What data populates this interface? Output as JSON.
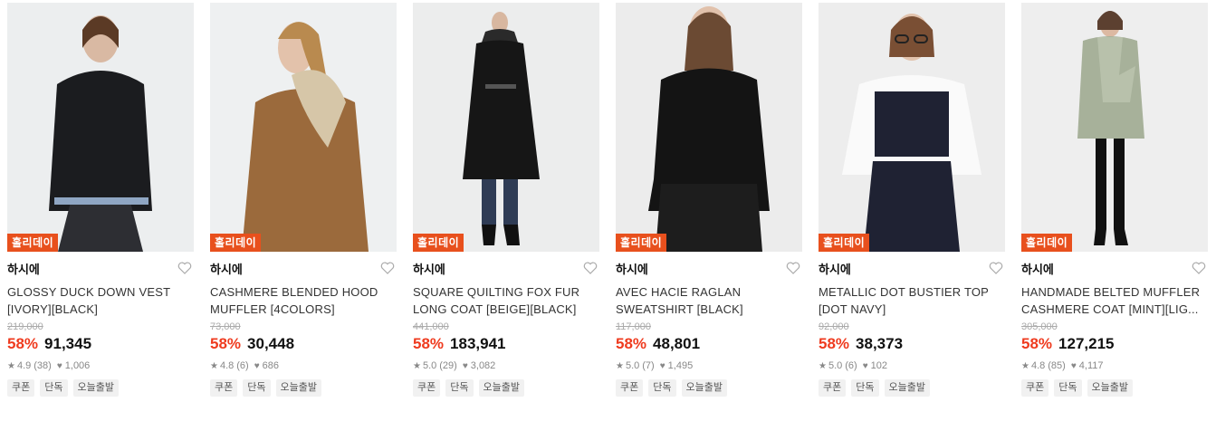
{
  "products": [
    {
      "badge": "홀리데이",
      "brand": "하시에",
      "name_line1": "GLOSSY DUCK DOWN VEST",
      "name_line2": "[IVORY][BLACK]",
      "original_price": "219,000",
      "discount": "58%",
      "price": "91,345",
      "rating": "4.9",
      "reviews": "(38)",
      "likes": "1,006",
      "tags": [
        "쿠폰",
        "단독",
        "오늘출발"
      ],
      "image_desc": "black-down-vest",
      "bg": "#eceeef",
      "garment": "#1b1c1f"
    },
    {
      "badge": "홀리데이",
      "brand": "하시에",
      "name_line1": "CASHMERE BLENDED HOOD",
      "name_line2": "MUFFLER [4COLORS]",
      "original_price": "73,000",
      "discount": "58%",
      "price": "30,448",
      "rating": "4.8",
      "reviews": "(6)",
      "likes": "686",
      "tags": [
        "쿠폰",
        "단독",
        "오늘출발"
      ],
      "image_desc": "camel-hood-muffler",
      "bg": "#eef0f1",
      "garment": "#9b6a3c"
    },
    {
      "badge": "홀리데이",
      "brand": "하시에",
      "name_line1": "SQUARE QUILTING FOX FUR",
      "name_line2": "LONG COAT [BEIGE][BLACK]",
      "original_price": "441,000",
      "discount": "58%",
      "price": "183,941",
      "rating": "5.0",
      "reviews": "(29)",
      "likes": "3,082",
      "tags": [
        "쿠폰",
        "단독",
        "오늘출발"
      ],
      "image_desc": "black-quilted-long-coat",
      "bg": "#eceded",
      "garment": "#161616"
    },
    {
      "badge": "홀리데이",
      "brand": "하시에",
      "name_line1": "AVEC HACIE RAGLAN",
      "name_line2": "SWEATSHIRT [BLACK]",
      "original_price": "117,000",
      "discount": "58%",
      "price": "48,801",
      "rating": "5.0",
      "reviews": "(7)",
      "likes": "1,495",
      "tags": [
        "쿠폰",
        "단독",
        "오늘출발"
      ],
      "image_desc": "black-raglan-sweatshirt",
      "bg": "#ececec",
      "garment": "#141414"
    },
    {
      "badge": "홀리데이",
      "brand": "하시에",
      "name_line1": "METALLIC DOT BUSTIER TOP",
      "name_line2": "[DOT NAVY]",
      "original_price": "92,000",
      "discount": "58%",
      "price": "38,373",
      "rating": "5.0",
      "reviews": "(6)",
      "likes": "102",
      "tags": [
        "쿠폰",
        "단독",
        "오늘출발"
      ],
      "image_desc": "navy-dot-bustier-top",
      "bg": "#ededed",
      "garment": "#1f2233"
    },
    {
      "badge": "홀리데이",
      "brand": "하시에",
      "name_line1": "HANDMADE BELTED MUFFLER",
      "name_line2": "CASHMERE COAT [MINT][LIG...",
      "original_price": "305,000",
      "discount": "58%",
      "price": "127,215",
      "rating": "4.8",
      "reviews": "(85)",
      "likes": "4,117",
      "tags": [
        "쿠폰",
        "단독",
        "오늘출발"
      ],
      "image_desc": "mint-belted-muffler-coat",
      "bg": "#eeeeee",
      "garment": "#a7b19a"
    }
  ]
}
